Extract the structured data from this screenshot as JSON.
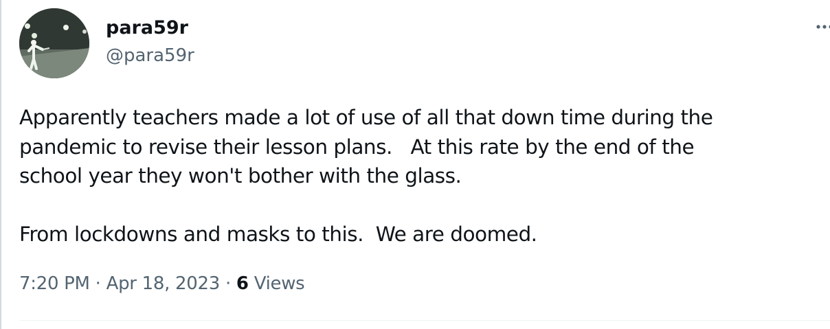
{
  "author": {
    "display_name": "para59r",
    "handle": "@para59r",
    "avatar_icon": "user-avatar-figure"
  },
  "tweet": {
    "lines": [
      "Apparently teachers made a lot of use of all that down time during the",
      "pandemic to revise their lesson plans.   At this rate by the end of the",
      "school year they won't bother with the glass.",
      "From lockdowns and masks to this.  We are doomed."
    ]
  },
  "meta": {
    "time": "7:20 PM",
    "separator": "·",
    "date": "Apr 18, 2023",
    "views_count": "6",
    "views_label": "Views"
  },
  "icons": {
    "more": "more-options-icon"
  },
  "colors": {
    "text_primary": "#0f1419",
    "text_secondary": "#536471",
    "divider": "#eff3f4"
  }
}
